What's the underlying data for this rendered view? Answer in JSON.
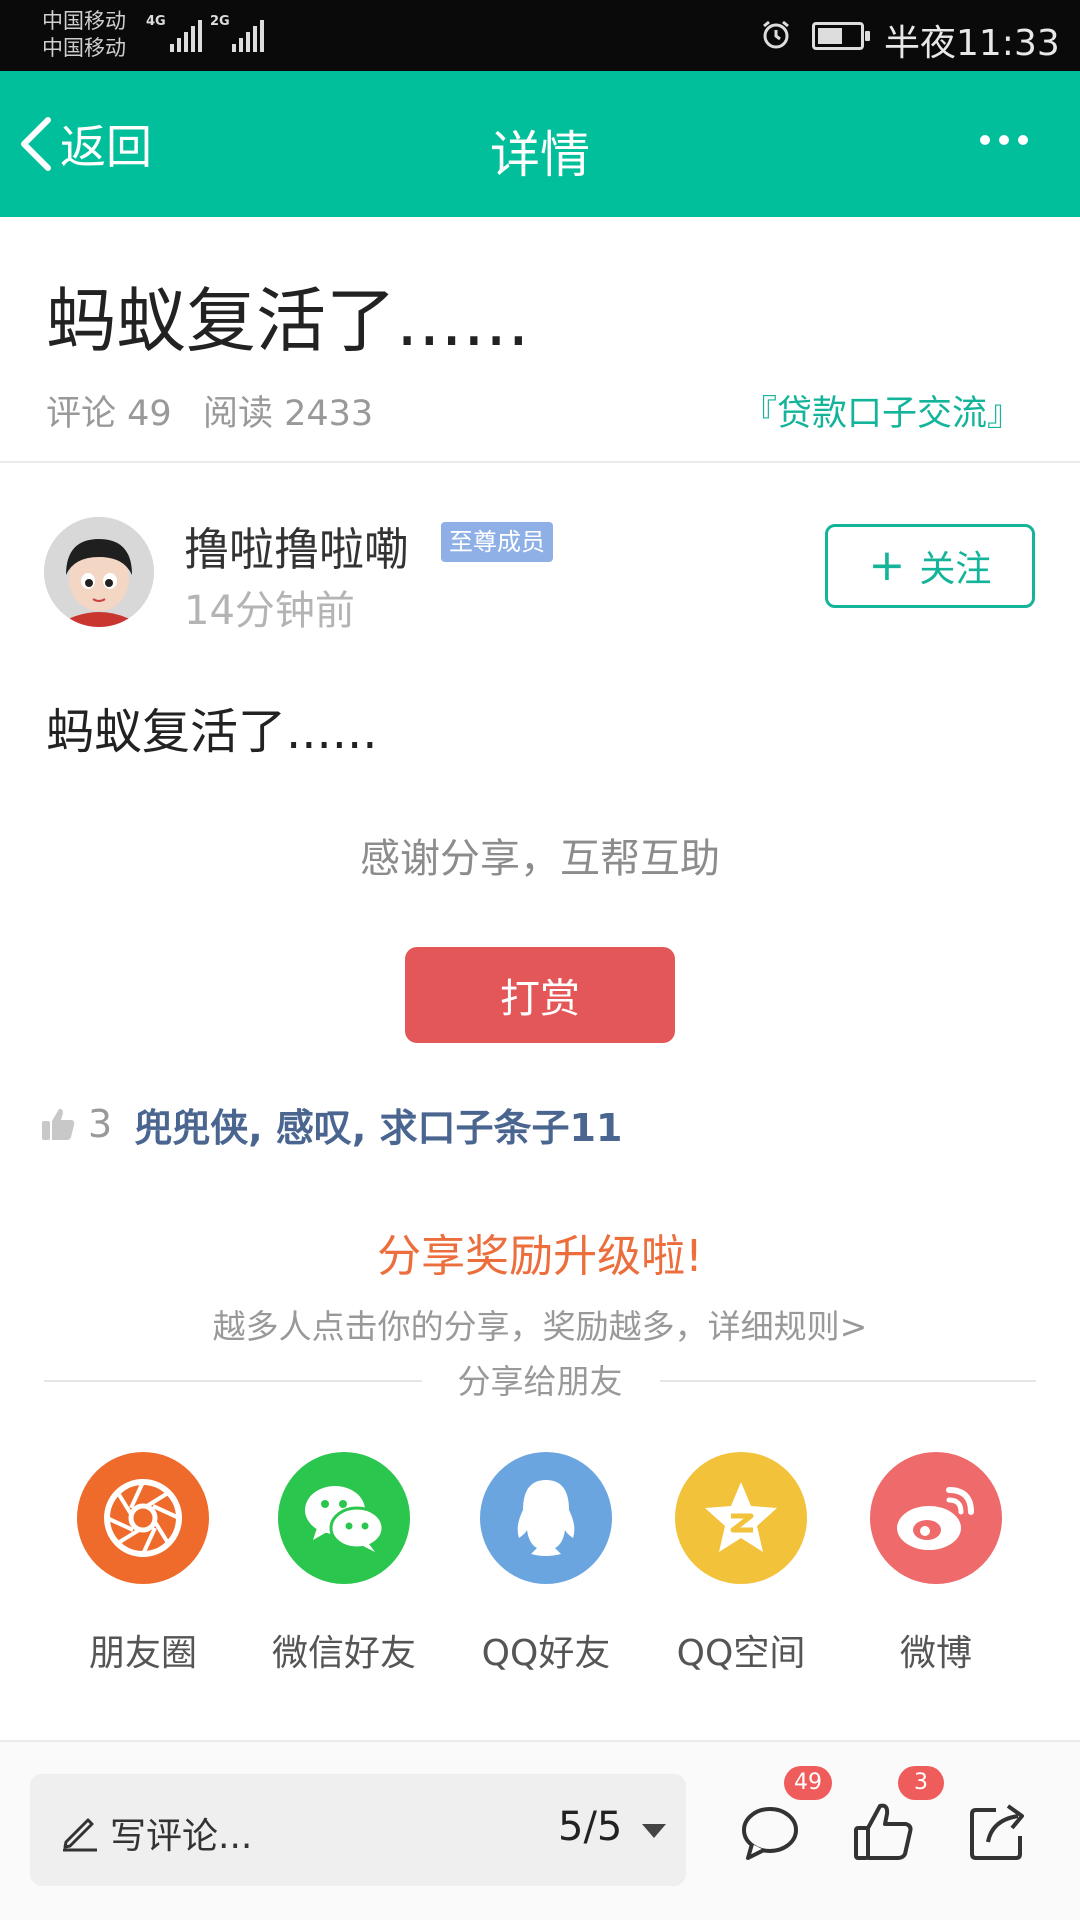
{
  "status_bar": {
    "carrier_1": "中国移动",
    "carrier_2": "中国移动",
    "net_1": "4G",
    "net_2": "2G",
    "time": "半夜11:33"
  },
  "app_bar": {
    "back_label": "返回",
    "title": "详情"
  },
  "post": {
    "title": "蚂蚁复活了......",
    "comments": "评论 49",
    "reads": "阅读 2433",
    "group": "『贷款口子交流』",
    "author": {
      "name": "撸啦撸啦嘞",
      "badge": "至尊成员",
      "time": "14分钟前",
      "follow_label": "关注"
    },
    "body": "蚂蚁复活了......",
    "thanks": "感谢分享，互帮互助",
    "reward_label": "打赏",
    "likes": {
      "count": "3",
      "users": "兜兜侠, 感叹, 求口子条子11"
    }
  },
  "share": {
    "promo_title": "分享奖励升级啦!",
    "promo_sub": "越多人点击你的分享，奖励越多，详细规则>",
    "heading": "分享给朋友",
    "targets": [
      {
        "label": "朋友圈",
        "icon": "moments-icon",
        "color": "#ef6b2b"
      },
      {
        "label": "微信好友",
        "icon": "wechat-icon",
        "color": "#2bc64e"
      },
      {
        "label": "QQ好友",
        "icon": "qq-icon",
        "color": "#6aa5e0"
      },
      {
        "label": "QQ空间",
        "icon": "qzone-icon",
        "color": "#f2c23a"
      },
      {
        "label": "微博",
        "icon": "weibo-icon",
        "color": "#ef6b6b"
      }
    ]
  },
  "bottom_bar": {
    "comment_placeholder": "写评论...",
    "page_indicator": "5/5",
    "comment_count": "49",
    "like_count": "3"
  },
  "colors": {
    "accent": "#00bf9a",
    "reward": "#e35758",
    "promo": "#ec6e3c",
    "link": "#4a6690",
    "badge": "#8fb0e6"
  }
}
